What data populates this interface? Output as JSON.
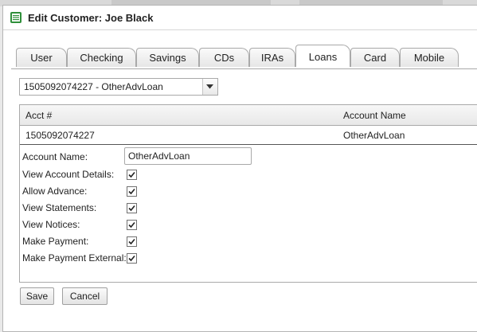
{
  "window": {
    "title": "Edit Customer: Joe Black"
  },
  "tabs": [
    {
      "label": "User"
    },
    {
      "label": "Checking"
    },
    {
      "label": "Savings"
    },
    {
      "label": "CDs"
    },
    {
      "label": "IRAs"
    },
    {
      "label": "Loans"
    },
    {
      "label": "Card"
    },
    {
      "label": "Mobile"
    }
  ],
  "active_tab": "Loans",
  "account_select": {
    "value": "1505092074227 - OtherAdvLoan"
  },
  "grid": {
    "columns": [
      "Acct #",
      "Account Name"
    ],
    "rows": [
      [
        "1505092074227",
        "OtherAdvLoan"
      ]
    ]
  },
  "detail": {
    "account_name_label": "Account Name:",
    "account_name_value": "OtherAdvLoan",
    "options": [
      {
        "label": "View Account Details:",
        "checked": true
      },
      {
        "label": "Allow Advance:",
        "checked": true
      },
      {
        "label": "View Statements:",
        "checked": true
      },
      {
        "label": "View Notices:",
        "checked": true
      },
      {
        "label": "Make Payment:",
        "checked": true
      },
      {
        "label": "Make Payment External:",
        "checked": true
      }
    ]
  },
  "buttons": {
    "save": "Save",
    "cancel": "Cancel"
  },
  "colors": {
    "border": "#a9a9a9",
    "background": "#ffffff",
    "chrome": "#e9e9e9"
  }
}
